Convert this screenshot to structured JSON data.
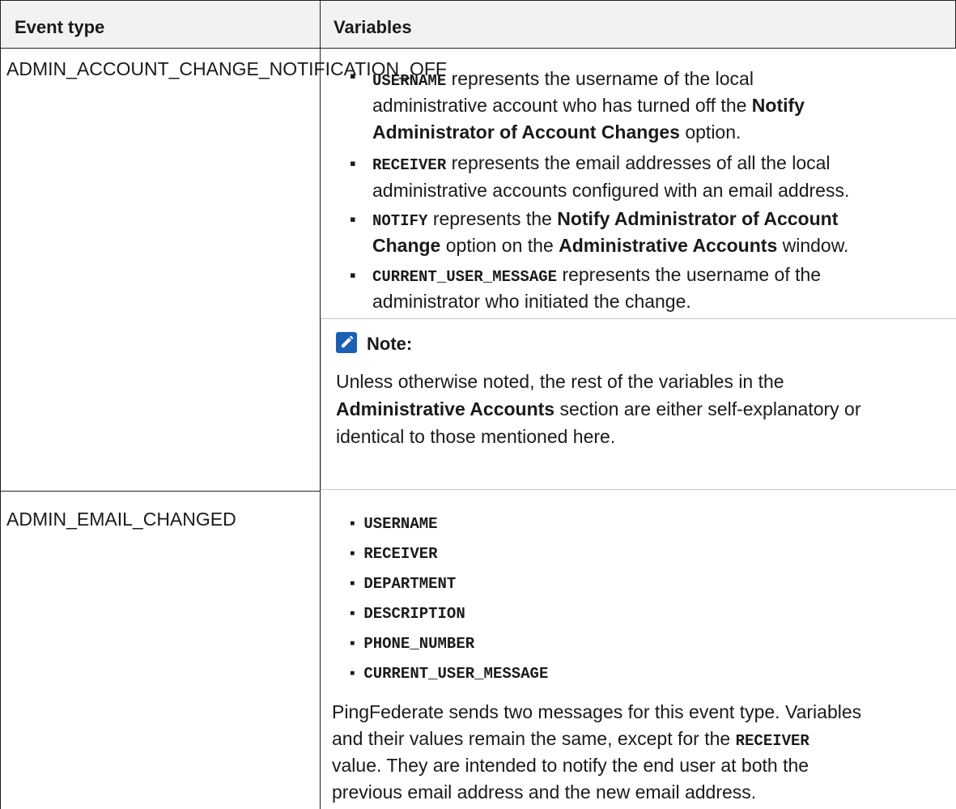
{
  "table": {
    "headers": [
      "Event type",
      "Variables"
    ],
    "rows": [
      {
        "event_type": "ADMIN_ACCOUNT_CHANGE_NOTIFICATION_OFF",
        "variables": [
          {
            "code": "USERNAME",
            "lines": [
              "represents the username of the local",
              "administrative account who has turned off the",
              "option."
            ],
            "bold_inline": [
              "Notify",
              "Administrator of Account Changes"
            ]
          },
          {
            "code": "RECEIVER",
            "lines": [
              "represents the email addresses of all the local",
              "administrative accounts configured with an email address."
            ]
          },
          {
            "code": "NOTIFY",
            "lines": [
              "represents the",
              "option on the",
              "window."
            ],
            "bold_inline": [
              "Notify Administrator of Account",
              "Change",
              "Administrative Accounts"
            ]
          },
          {
            "code": "CURRENT_USER_MESSAGE",
            "lines": [
              "represents the username of the",
              "administrator who initiated the change."
            ]
          }
        ],
        "note": {
          "title": "Note:",
          "body_lines": [
            "Unless otherwise noted, the rest of the variables in the",
            "section are either self-explanatory or",
            "identical to those mentioned here."
          ],
          "bold": "Administrative Accounts"
        }
      },
      {
        "event_type": "ADMIN_EMAIL_CHANGED",
        "variables": [
          "USERNAME",
          "RECEIVER",
          "DEPARTMENT",
          "DESCRIPTION",
          "PHONE_NUMBER",
          "CURRENT_USER_MESSAGE"
        ],
        "paragraph": {
          "line1": "PingFederate sends two messages for this event type. Variables",
          "line2_pre": "and their values remain the same, except for the",
          "line2_code": "RECEIVER",
          "line3": "value. They are intended to notify the end user at both the",
          "line4": "previous email address and the new email address."
        }
      }
    ]
  },
  "colors": {
    "header_bg": "#f2f2f2",
    "note_icon": "#1a5fb4",
    "border": "#222222"
  },
  "icons": {
    "note": "pencil-note-icon"
  }
}
